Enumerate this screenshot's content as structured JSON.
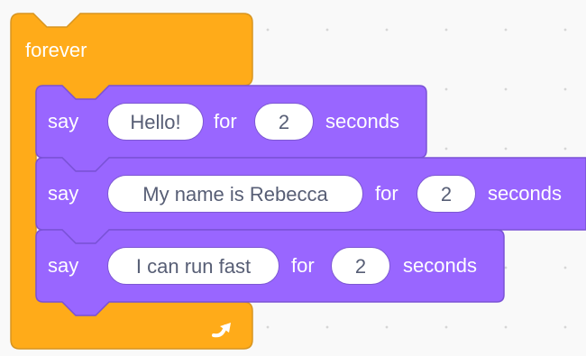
{
  "workspace": {
    "forever_block": {
      "label": "forever",
      "color": "#ffab19",
      "border_color": "#d89520",
      "loop_icon": "loop-arrow-icon"
    },
    "say_blocks": [
      {
        "say_label": "say",
        "message": "Hello!",
        "for_label": "for",
        "seconds_value": "2",
        "seconds_label": "seconds"
      },
      {
        "say_label": "say",
        "message": "My name is Rebecca",
        "for_label": "for",
        "seconds_value": "2",
        "seconds_label": "seconds"
      },
      {
        "say_label": "say",
        "message": "I can run fast",
        "for_label": "for",
        "seconds_value": "2",
        "seconds_label": "seconds"
      }
    ],
    "say_block_color": "#9966ff",
    "say_block_border_color": "#7a52d6",
    "input_text_color": "#575e75"
  }
}
